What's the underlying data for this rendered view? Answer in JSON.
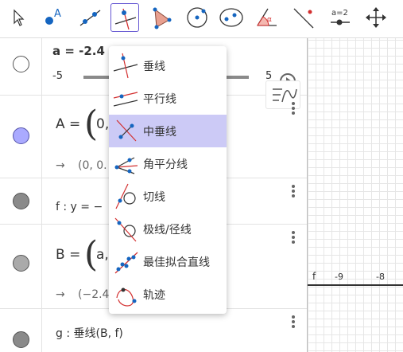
{
  "toolbar": {
    "tools": [
      {
        "name": "move-tool-icon",
        "active": false
      },
      {
        "name": "point-tool-icon",
        "point_label": "A",
        "active": false
      },
      {
        "name": "line-tool-icon",
        "active": false
      },
      {
        "name": "perpendicular-line-tool-icon",
        "active": true
      },
      {
        "name": "polygon-tool-icon",
        "active": false
      },
      {
        "name": "circle-center-point-tool-icon",
        "active": false
      },
      {
        "name": "ellipse-tool-icon",
        "active": false
      },
      {
        "name": "angle-tool-icon",
        "angle_symbol": "α",
        "active": false
      },
      {
        "name": "reflect-tool-icon",
        "active": false
      },
      {
        "name": "slider-tool-icon",
        "slider_label": "a=2",
        "active": false
      },
      {
        "name": "move-graphics-view-icon",
        "active": false
      }
    ]
  },
  "algebra": {
    "slider_row": {
      "definition": "a = -2.4",
      "min": "-5",
      "max": "5",
      "value": -2.4
    },
    "point_A_row": {
      "lhs": "A =",
      "inner": "0,",
      "output": "(0, 0."
    },
    "line_f_row": {
      "text": "f : y = −"
    },
    "point_B_row": {
      "lhs": "B =",
      "inner": "a,",
      "output": "(−2.4,"
    },
    "line_g_row": {
      "text": "g : 垂线(B, f)"
    }
  },
  "graphics": {
    "axis_label": "f",
    "tick_labels": [
      "-9",
      "-8"
    ]
  },
  "menu": {
    "items": [
      {
        "label": "垂线",
        "icon": "perpendicular-line-icon",
        "selected": false
      },
      {
        "label": "平行线",
        "icon": "parallel-line-icon",
        "selected": false
      },
      {
        "label": "中垂线",
        "icon": "perpendicular-bisector-icon",
        "selected": true
      },
      {
        "label": "角平分线",
        "icon": "angle-bisector-icon",
        "selected": false
      },
      {
        "label": "切线",
        "icon": "tangent-icon",
        "selected": false
      },
      {
        "label": "极线/径线",
        "icon": "polar-diameter-line-icon",
        "selected": false
      },
      {
        "label": "最佳拟合直线",
        "icon": "best-fit-line-icon",
        "selected": false
      },
      {
        "label": "轨迹",
        "icon": "locus-icon",
        "selected": false
      }
    ]
  },
  "colors": {
    "accent": "#6557d2",
    "selection": "#cccaf6",
    "point_fill": "#aaaaff",
    "point_blue": "#1565c0",
    "line_red": "#d32f2f"
  }
}
